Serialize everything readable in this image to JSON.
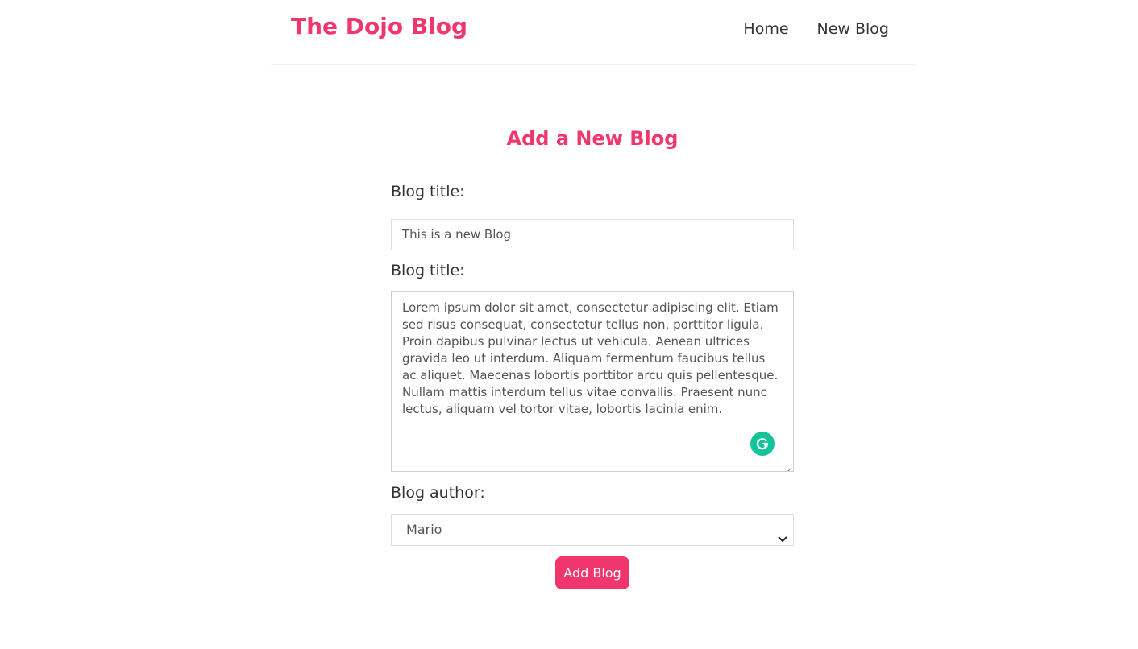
{
  "navbar": {
    "brand": "The Dojo Blog",
    "links": [
      {
        "label": "Home"
      },
      {
        "label": "New Blog"
      }
    ]
  },
  "form": {
    "heading": "Add a New Blog",
    "title_label": "Blog title:",
    "title_value": "This is a new Blog",
    "body_label": "Blog title:",
    "body_value": "Lorem ipsum dolor sit amet, consectetur adipiscing elit. Etiam sed risus consequat, consectetur tellus non, porttitor ligula. Proin dapibus pulvinar lectus ut vehicula. Aenean ultrices gravida leo ut interdum. Aliquam fermentum faucibus tellus ac aliquet. Maecenas lobortis porttitor arcu quis pellentesque. Nullam mattis interdum tellus vitae convallis. Praesent nunc lectus, aliquam vel tortor vitae, lobortis lacinia enim.",
    "author_label": "Blog author:",
    "author_value": "Mario",
    "submit_label": "Add Blog"
  },
  "icons": {
    "grammarly": "grammarly-icon",
    "chevron": "chevron-down-icon",
    "resize": "resize-handle-icon"
  },
  "colors": {
    "accent": "#f1356d",
    "grammarly": "#15c39a",
    "text": "#333333"
  }
}
